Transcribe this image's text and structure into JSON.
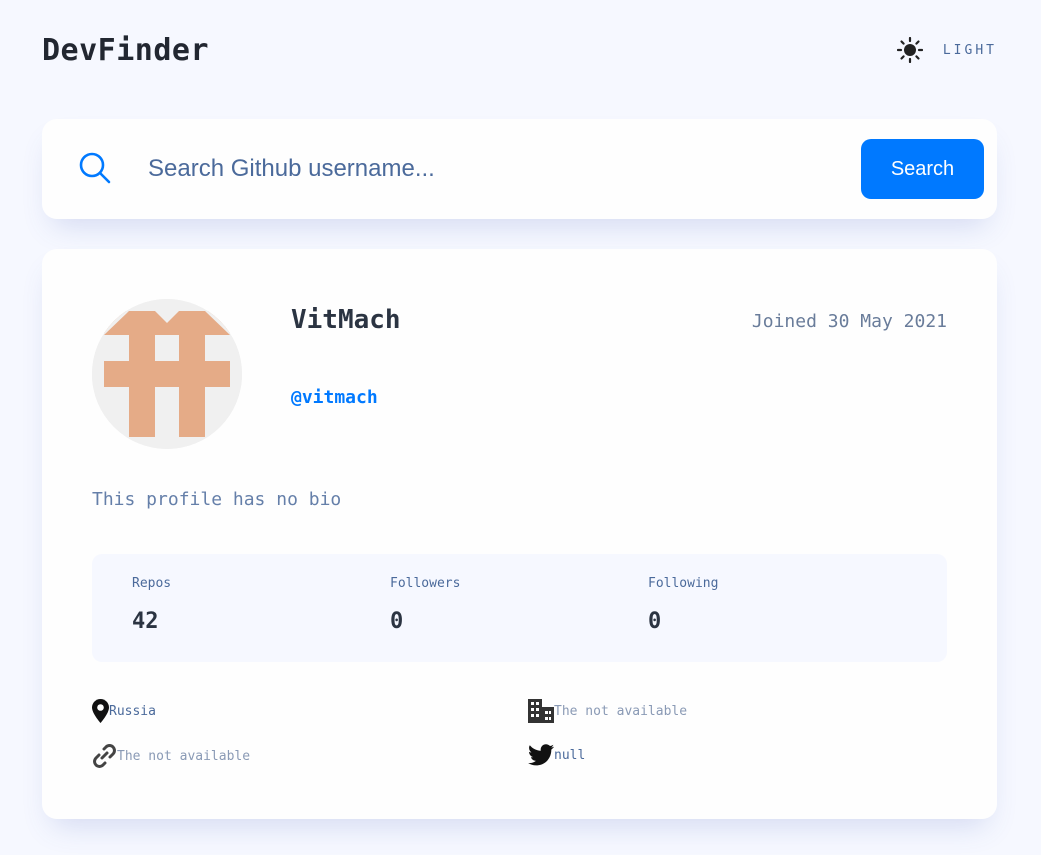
{
  "app": {
    "title": "DevFinder"
  },
  "theme_toggle": {
    "label": "LIGHT",
    "icon": "sun-icon"
  },
  "search": {
    "placeholder": "Search Github username...",
    "value": "",
    "button_label": "Search",
    "icon": "search-icon"
  },
  "profile": {
    "name": "VitMach",
    "joined": "Joined 30 May 2021",
    "login": "@vitmach",
    "bio": "This profile has no bio",
    "stats": [
      {
        "label": "Repos",
        "value": "42"
      },
      {
        "label": "Followers",
        "value": "0"
      },
      {
        "label": "Following",
        "value": "0"
      }
    ],
    "links": {
      "location": "Russia",
      "company": "The not available",
      "blog": "The not available",
      "twitter": "null"
    }
  },
  "colors": {
    "accent": "#0079ff",
    "background": "#f6f8ff",
    "card": "#fefefe",
    "text_primary": "#2b3442",
    "text_secondary": "#4b6a9b",
    "avatar_identicon": "#e5ab87"
  }
}
